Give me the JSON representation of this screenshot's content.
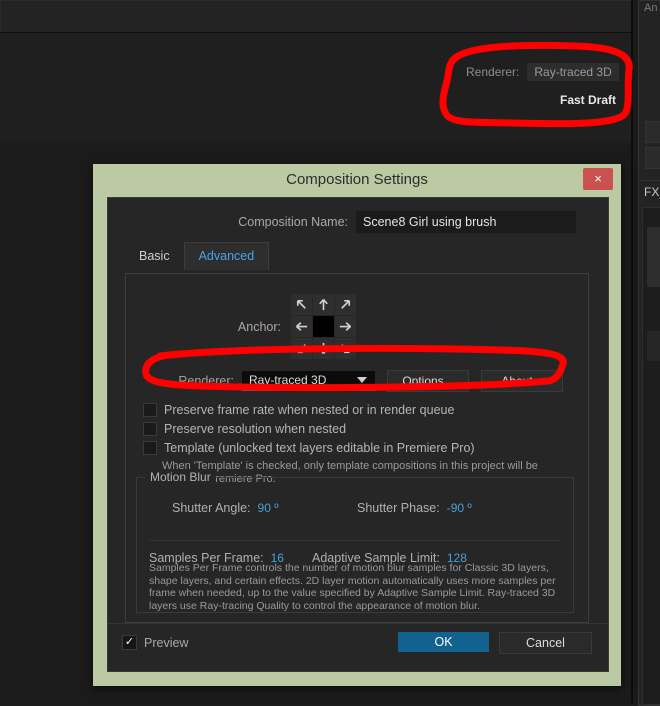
{
  "background": {
    "renderer_readout_label": "Renderer:",
    "renderer_readout_value": "Ray-traced 3D",
    "fast_draft_label": "Fast Draft",
    "right_panel_top_caption": "An",
    "right_panel_bottom_caption": "FX_"
  },
  "dialog": {
    "title": "Composition Settings",
    "close_label": "×",
    "composition_name": {
      "label": "Composition Name:",
      "value": "Scene8 Girl using brush"
    },
    "tabs": [
      {
        "label": "Basic",
        "active": false
      },
      {
        "label": "Advanced",
        "active": true
      }
    ],
    "anchor": {
      "label": "Anchor:",
      "cells": [
        "arrow-up-left-icon",
        "arrow-up-icon",
        "arrow-up-right-icon",
        "arrow-left-icon",
        "anchor-center",
        "arrow-right-icon",
        "arrow-down-left-icon",
        "arrow-down-icon",
        "arrow-down-right-icon"
      ]
    },
    "renderer": {
      "label": "Renderer:",
      "value": "Ray-traced 3D",
      "options_button": "Options...",
      "about_button": "About..."
    },
    "checkboxes": [
      {
        "label": "Preserve frame rate when nested or in render queue",
        "checked": false
      },
      {
        "label": "Preserve resolution when nested",
        "checked": false
      },
      {
        "label": "Template (unlocked text layers editable in Premiere Pro)",
        "checked": false
      }
    ],
    "template_note": "When 'Template' is checked, only template compositions in this project will be visible to Premiere Pro.",
    "motion_blur": {
      "caption": "Motion Blur",
      "shutter_angle_label": "Shutter Angle:",
      "shutter_angle_value": "90 º",
      "shutter_phase_label": "Shutter Phase:",
      "shutter_phase_value": "-90 º",
      "samples_per_frame_label": "Samples Per Frame:",
      "samples_per_frame_value": "16",
      "adaptive_sample_limit_label": "Adaptive Sample Limit:",
      "adaptive_sample_limit_value": "128",
      "note": "Samples Per Frame controls the number of motion blur samples for Classic 3D layers, shape layers, and certain effects. 2D layer motion automatically uses more samples per frame when needed, up to the value specified by Adaptive Sample Limit. Ray-traced 3D layers use Ray-tracing Quality to control the appearance of motion blur."
    },
    "footer": {
      "preview_label": "Preview",
      "preview_checked": true,
      "preview_check_glyph": "✓",
      "ok_label": "OK",
      "cancel_label": "Cancel"
    }
  },
  "colors": {
    "title_bar": "#bccaa4",
    "close_button": "#c9514f",
    "accent_blue": "#4a9fd8",
    "ok_button": "#12628f",
    "annotation_red": "#fe0000"
  }
}
